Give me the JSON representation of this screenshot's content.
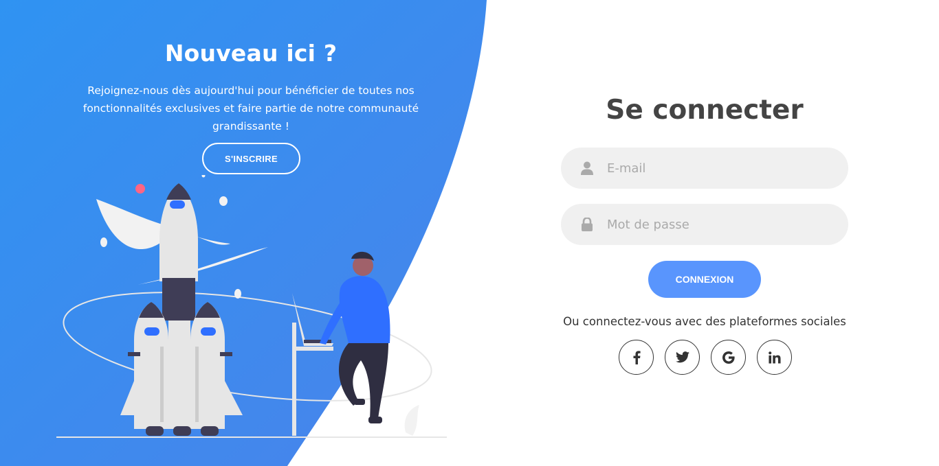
{
  "left": {
    "title": "Nouveau ici ?",
    "description": "Rejoignez-nous dès aujourd'hui pour bénéficier de toutes nos fonctionnalités exclusives et faire partie de notre communauté grandissante !",
    "signup_label": "S'INSCRIRE"
  },
  "login": {
    "title": "Se connecter",
    "email_placeholder": "E-mail",
    "password_placeholder": "Mot de passe",
    "submit_label": "CONNEXION",
    "social_text": "Ou connectez-vous avec des plateformes sociales",
    "social": [
      {
        "icon": "facebook-icon",
        "glyph": "f"
      },
      {
        "icon": "twitter-icon",
        "glyph": "t"
      },
      {
        "icon": "google-icon",
        "glyph": "G"
      },
      {
        "icon": "linkedin-icon",
        "glyph": "in"
      }
    ]
  },
  "colors": {
    "primary_blue": "#4481eb",
    "accent_blue": "#04befe",
    "button_blue": "#5995fd",
    "title_gray": "#444444",
    "field_bg": "#f0f0f0"
  }
}
